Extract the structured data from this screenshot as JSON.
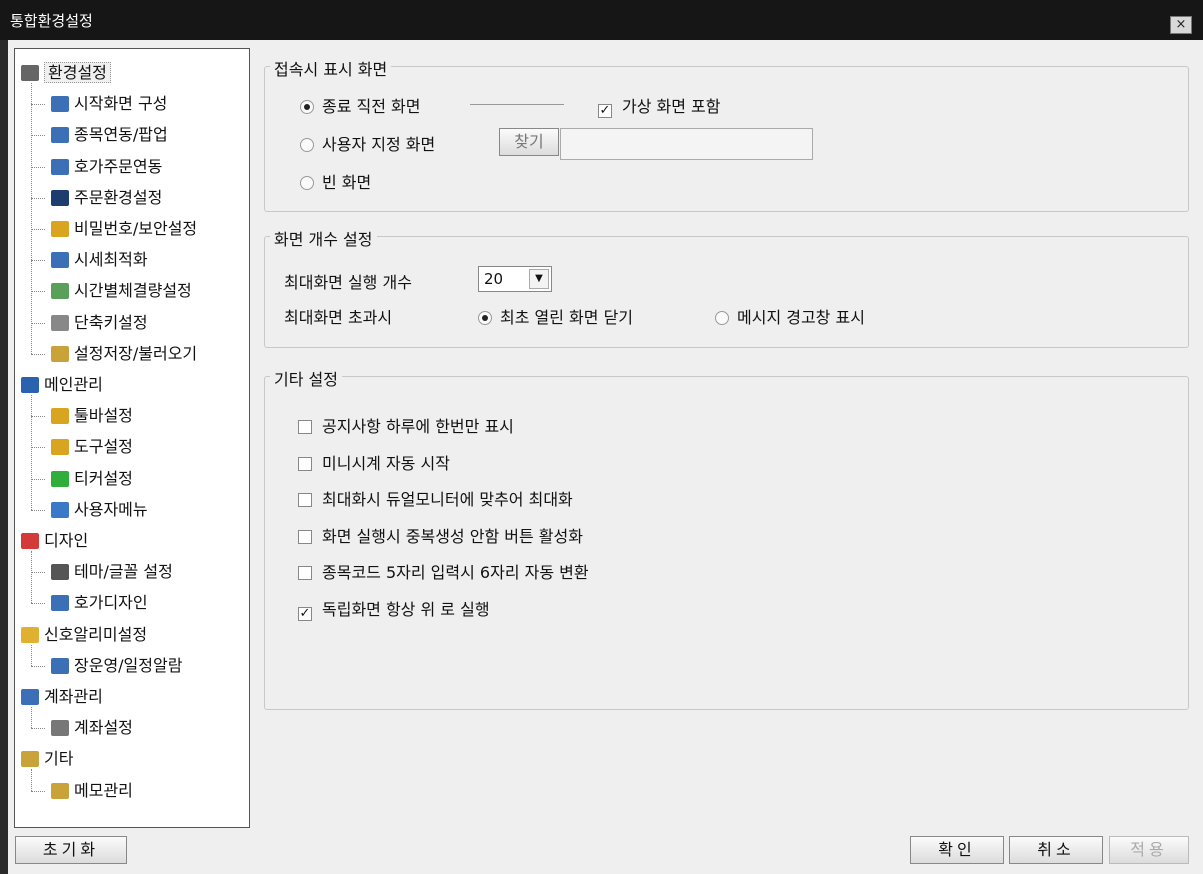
{
  "window": {
    "title": "통합환경설정",
    "close_glyph": "×"
  },
  "tree": {
    "env": {
      "label": "환경설정",
      "children": [
        "시작화면 구성",
        "종목연동/팝업",
        "호가주문연동",
        "주문환경설정",
        "비밀번호/보안설정",
        "시세최적화",
        "시간별체결량설정",
        "단축키설정",
        "설정저장/불러오기"
      ]
    },
    "main": {
      "label": "메인관리",
      "children": [
        "툴바설정",
        "도구설정",
        "티커설정",
        "사용자메뉴"
      ]
    },
    "design": {
      "label": "디자인",
      "children": [
        "테마/글꼴 설정",
        "호가디자인"
      ]
    },
    "signal": {
      "label": "신호알리미설정",
      "children": [
        "장운영/일정알람"
      ]
    },
    "account": {
      "label": "계좌관리",
      "children": [
        "계좌설정"
      ]
    },
    "etc": {
      "label": "기타",
      "children": [
        "메모관리"
      ]
    }
  },
  "startup": {
    "legend": "접속시 표시 화면",
    "opt_last": "종료 직전 화면",
    "opt_last_checked": true,
    "include_virtual": "가상 화면 포함",
    "include_virtual_checked": true,
    "opt_user": "사용자 지정 화면",
    "find_button": "찾기",
    "path_value": "",
    "opt_blank": "빈 화면"
  },
  "count": {
    "legend": "화면 개수 설정",
    "max_label": "최대화면 실행 개수",
    "max_value": "20",
    "exceed_label": "최대화면 초과시",
    "opt_close_first": "최초 열린 화면 닫기",
    "opt_close_first_checked": true,
    "opt_warn": "메시지 경고창 표시"
  },
  "etc_settings": {
    "legend": "기타 설정",
    "items": [
      {
        "label": "공지사항 하루에 한번만 표시",
        "checked": false
      },
      {
        "label": "미니시계 자동 시작",
        "checked": false
      },
      {
        "label": "최대화시 듀얼모니터에 맞추어 최대화",
        "checked": false
      },
      {
        "label": "화면 실행시 중복생성 안함 버튼 활성화",
        "checked": false
      },
      {
        "label": "종목코드 5자리 입력시 6자리 자동 변환",
        "checked": false
      },
      {
        "label": "독립화면 항상 위 로 실행",
        "checked": true
      }
    ]
  },
  "footer": {
    "reset": "초기화",
    "ok": "확인",
    "cancel": "취소",
    "apply": "적용"
  },
  "icon_colors": {
    "gear": "#666666",
    "screen": "#3b6fb6",
    "key": "#d9a520",
    "clock": "#5aa05a",
    "keyboard": "#888888",
    "folder": "#c9a33a",
    "monitor": "#2a62b0",
    "shield": "#2fae3b",
    "person": "#3b78c8",
    "blocks": "#d33b3b",
    "bell": "#e0b030"
  }
}
